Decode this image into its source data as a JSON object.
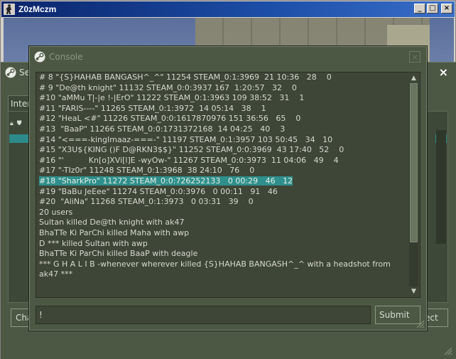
{
  "window": {
    "title": "Z0zMczm",
    "minimize_label": "_",
    "maximize_label": "□",
    "close_label": "×"
  },
  "browser": {
    "title": "Se",
    "close_label": "×",
    "tab_label": "Inter",
    "left_button_label": "Cha",
    "right_button_label": "ect"
  },
  "console": {
    "title": "Console",
    "close_label": "×",
    "lines": [
      "# 8 \"{S}HAHAB BANGASH^_^\" 11254 STEAM_0:1:3969  21 10:36   28    0",
      "# 9 \"De@th knight\" 11132 STEAM_0:0:3937 167  1:20:57   32    0",
      "#10 \"aMMu T|-|e !-|ErO\" 11222 STEAM_0:1:3963 109 38:52   31    1",
      "#11 \"FARIS----\" 11265 STEAM_0:1:3972  14 05:14   38    1",
      "#12 \"HeaL <#\" 11226 STEAM_0:0:1617870976 151 36:56   65    0",
      "#13  \"BaaP\" 11266 STEAM_0:0:1731372168  14 04:25   40    3",
      "#14 \"<===-kingImaaz-===-\" 11197 STEAM_0:1:3957 103 50:45   34   10",
      "#15 \"X3U${KING ()F D@RKN3$$}\" 11252 STEAM_0:0:3969  43 17:40   52    0",
      "#16 \"'          Kn[o]XVi[l]E -wyOw-\" 11267 STEAM_0:0:3973  11 04:06   49    4",
      "#17 \"-TIz0r\" 11248 STEAM_0:1:3968  38 24:10   76    0",
      "#18 \"SharkPro\" 11272 STEAM_0:0:726252133   0 00:29   46   12",
      "#19 \"BaBu JeEee\" 11274 STEAM_0:0:3976   0 00:11   91   46",
      "#20  \"AliNa\" 11268 STEAM_0:1:3973   0 03:31   39    0",
      "20 users",
      "Sultan killed De@th knight with ak47",
      "BhaTTe Ki ParChi killed Maha with awp",
      "D *** killed Sultan with awp",
      "BhaTTe Ki ParChi killed BaaP with deagle",
      "*** G H A L I B -whenever wherever killed {S}HAHAB BANGASH^_^ with a headshot from ak47 ***"
    ],
    "selected_line_index": 10,
    "input_value": "!",
    "submit_label": "Submit"
  },
  "icons": {
    "app_icon": "cs-player-icon",
    "steam_icon": "steam-logo-icon"
  },
  "colors": {
    "titlebar": "#0a246a",
    "panel": "#4c5844",
    "console_bg": "#3e4637",
    "selection": "#2f8f8c",
    "text": "#d6d9d0"
  }
}
